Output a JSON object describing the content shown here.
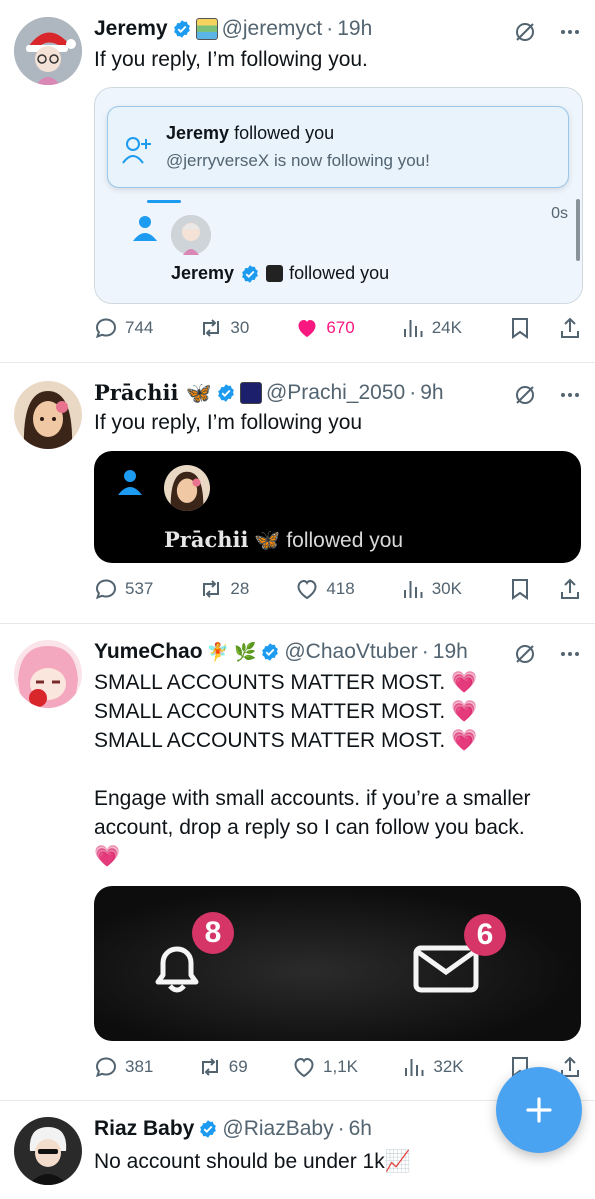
{
  "colors": {
    "accent": "#1d9bf0",
    "like": "#f91880",
    "muted": "#536471",
    "verified": "#1d9bf0"
  },
  "tweets": [
    {
      "name": "Jeremy",
      "handle": "@jeremyct",
      "dot": "·",
      "time": "19h",
      "text": "If you reply, I’m following you.",
      "media": {
        "toast_title_name": "Jeremy",
        "toast_title_rest": " followed you",
        "toast_sub": "@jerryverseX is now following you!",
        "row_time": "0s",
        "row_name": "Jeremy",
        "row_rest": "followed you"
      },
      "replies": "744",
      "reposts": "30",
      "likes": "670",
      "views": "24K"
    },
    {
      "name": "Prāchii",
      "name_emoji": "🦋",
      "handle": "@Prachi_2050",
      "dot": "·",
      "time": "9h",
      "text": "If you reply, I’m following you",
      "media": {
        "row_name": "Prāchii",
        "row_emoji": "🦋",
        "row_rest": "followed you"
      },
      "replies": "537",
      "reposts": "28",
      "likes": "418",
      "views": "30K"
    },
    {
      "name": "YumeChao",
      "name_emoji": "🧚 🌿",
      "handle": "@ChaoVtuber",
      "dot": "·",
      "time": "19h",
      "lines": [
        "SMALL ACCOUNTS MATTER MOST.",
        "SMALL ACCOUNTS MATTER MOST.",
        "SMALL ACCOUNTS MATTER MOST.",
        "Engage with small accounts. if you’re a smaller",
        "account, drop a reply so I can follow you back."
      ],
      "heart_emoji": "💗",
      "media": {
        "bell_count": "8",
        "mail_count": "6"
      },
      "replies": "381",
      "reposts": "69",
      "likes": "1,1K",
      "views": "32K"
    },
    {
      "name": "Riaz Baby",
      "handle": "@RiazBaby",
      "dot": "·",
      "time": "6h",
      "text": "No account should be under 1k",
      "text_emoji": "📈"
    }
  ],
  "icons": {
    "verified": "verified-badge-icon",
    "grok": "slashed-circle-icon",
    "more": "more-icon",
    "reply": "reply-icon",
    "repost": "repost-icon",
    "like": "heart-icon",
    "views": "views-icon",
    "bookmark": "bookmark-icon",
    "share": "share-icon",
    "compose": "plus-icon"
  }
}
